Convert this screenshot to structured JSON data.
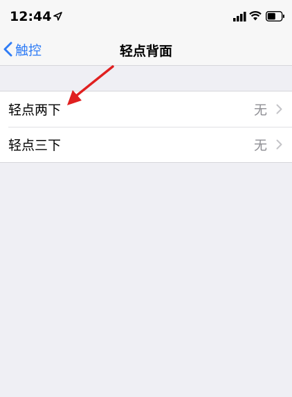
{
  "status_bar": {
    "time": "12:44",
    "location_icon": "location-arrow-icon",
    "signal_icon": "cellular-signal-icon",
    "wifi_icon": "wifi-icon",
    "battery_icon": "battery-icon"
  },
  "nav": {
    "back_label": "触控",
    "back_icon": "chevron-left-icon",
    "title": "轻点背面"
  },
  "rows": [
    {
      "label": "轻点两下",
      "value": "无",
      "icon": "chevron-right-icon"
    },
    {
      "label": "轻点三下",
      "value": "无",
      "icon": "chevron-right-icon"
    }
  ],
  "annotation": {
    "icon": "red-arrow-icon",
    "color": "#e02020"
  },
  "colors": {
    "accent": "#2f7cf6",
    "background": "#efeff4",
    "secondary_text": "#8e8e93"
  }
}
